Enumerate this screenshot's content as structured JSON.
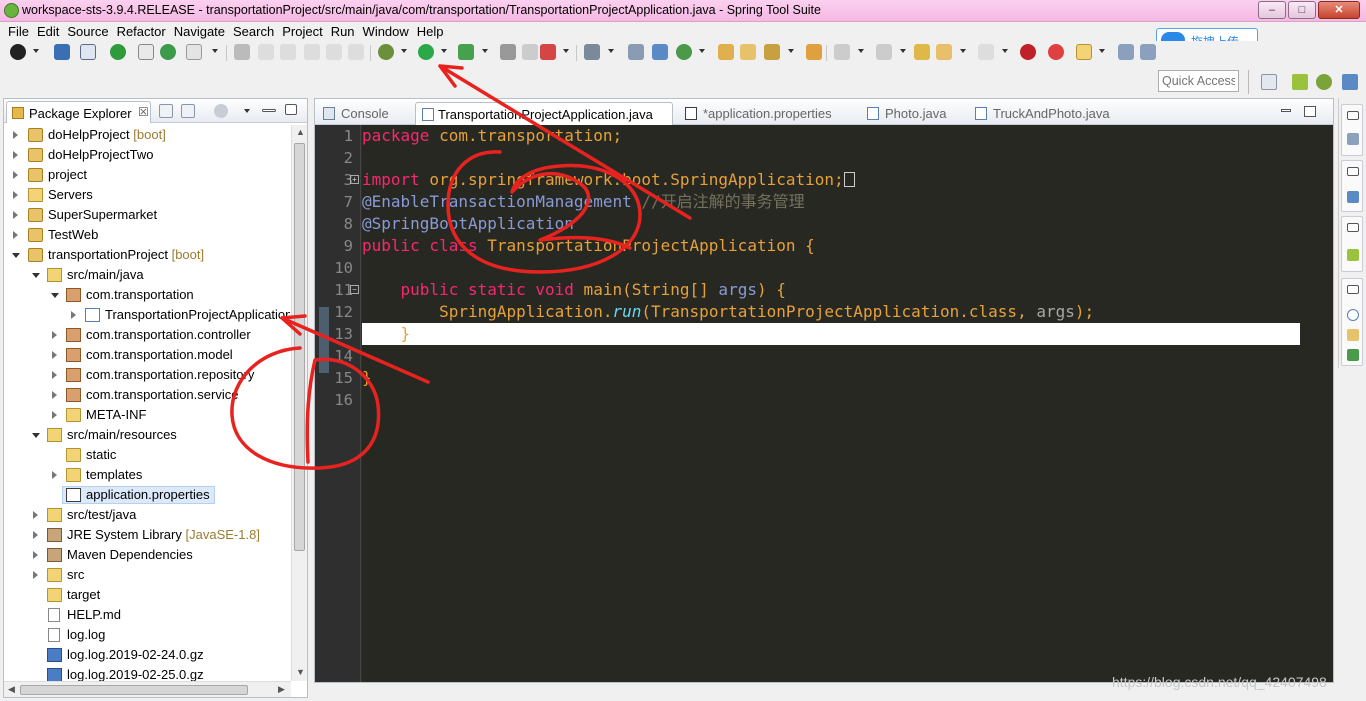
{
  "window": {
    "title": "workspace-sts-3.9.4.RELEASE - transportationProject/src/main/java/com/transportation/TransportationProjectApplication.java - Spring Tool Suite",
    "minimize": "–",
    "maximize": "□",
    "close": "✕"
  },
  "menu": [
    "File",
    "Edit",
    "Source",
    "Refactor",
    "Navigate",
    "Search",
    "Project",
    "Run",
    "Window",
    "Help"
  ],
  "upload": {
    "label": "拖拽上传"
  },
  "quick_access": {
    "placeholder": "Quick Access"
  },
  "package_explorer": {
    "tab_label": "Package Explorer",
    "close_glyph": "☒",
    "tree": [
      {
        "label": "doHelpProject",
        "decoration": "[boot]",
        "icon": "project-icon",
        "twisty": "closed"
      },
      {
        "label": "doHelpProjectTwo",
        "decoration": "",
        "icon": "project-icon",
        "twisty": "closed"
      },
      {
        "label": "project",
        "decoration": "",
        "icon": "project-icon",
        "twisty": "closed"
      },
      {
        "label": "Servers",
        "decoration": "",
        "icon": "folder-icon",
        "twisty": "closed"
      },
      {
        "label": "SuperSupermarket",
        "decoration": "",
        "icon": "project-icon",
        "twisty": "closed"
      },
      {
        "label": "TestWeb",
        "decoration": "",
        "icon": "project-icon",
        "twisty": "closed"
      },
      {
        "label": "transportationProject",
        "decoration": "[boot]",
        "icon": "project-icon",
        "twisty": "open"
      },
      {
        "label": "src/main/java",
        "decoration": "",
        "icon": "source-folder-icon",
        "twisty": "open"
      },
      {
        "label": "com.transportation",
        "decoration": "",
        "icon": "package-icon",
        "twisty": "open"
      },
      {
        "label": "TransportationProjectApplication.java",
        "decoration": "",
        "icon": "java-file-icon",
        "twisty": "closed"
      },
      {
        "label": "com.transportation.controller",
        "decoration": "",
        "icon": "package-icon",
        "twisty": "closed"
      },
      {
        "label": "com.transportation.model",
        "decoration": "",
        "icon": "package-icon",
        "twisty": "closed"
      },
      {
        "label": "com.transportation.repository",
        "decoration": "",
        "icon": "package-icon",
        "twisty": "closed"
      },
      {
        "label": "com.transportation.service",
        "decoration": "",
        "icon": "package-icon",
        "twisty": "closed"
      },
      {
        "label": "META-INF",
        "decoration": "",
        "icon": "folder-icon",
        "twisty": "closed"
      },
      {
        "label": "src/main/resources",
        "decoration": "",
        "icon": "source-folder-icon",
        "twisty": "open"
      },
      {
        "label": "static",
        "decoration": "",
        "icon": "folder-icon",
        "twisty": "none"
      },
      {
        "label": "templates",
        "decoration": "",
        "icon": "folder-icon",
        "twisty": "closed"
      },
      {
        "label": "application.properties",
        "decoration": "",
        "icon": "properties-file-icon",
        "twisty": "none"
      },
      {
        "label": "src/test/java",
        "decoration": "",
        "icon": "source-folder-icon",
        "twisty": "closed"
      },
      {
        "label": "JRE System Library",
        "decoration": "[JavaSE-1.8]",
        "icon": "library-icon",
        "twisty": "closed"
      },
      {
        "label": "Maven Dependencies",
        "decoration": "",
        "icon": "library-icon",
        "twisty": "closed"
      },
      {
        "label": "src",
        "decoration": "",
        "icon": "folder-icon",
        "twisty": "closed"
      },
      {
        "label": "target",
        "decoration": "",
        "icon": "folder-icon",
        "twisty": "none"
      },
      {
        "label": "HELP.md",
        "decoration": "",
        "icon": "file-icon",
        "twisty": "none"
      },
      {
        "label": "log.log",
        "decoration": "",
        "icon": "file-icon",
        "twisty": "none"
      },
      {
        "label": "log.log.2019-02-24.0.gz",
        "decoration": "",
        "icon": "archive-icon",
        "twisty": "none"
      },
      {
        "label": "log.log.2019-02-25.0.gz",
        "decoration": "",
        "icon": "archive-icon",
        "twisty": "none"
      }
    ]
  },
  "editor": {
    "tabs": [
      {
        "label": "Console",
        "active": false,
        "icon": "console-icon"
      },
      {
        "label": "TransportationProjectApplication.java",
        "active": true,
        "icon": "java-file-icon"
      },
      {
        "label": "*application.properties",
        "active": false,
        "icon": "properties-file-icon"
      },
      {
        "label": "Photo.java",
        "active": false,
        "icon": "java-file-icon"
      },
      {
        "label": "TruckAndPhoto.java",
        "active": false,
        "icon": "java-file-icon"
      }
    ],
    "line_numbers": [
      "1",
      "2",
      "3",
      "7",
      "8",
      "9",
      "10",
      "11",
      "12",
      "13",
      "14",
      "15",
      "16"
    ],
    "code": {
      "l1_kw": "package",
      "l1_rest": " com.transportation;",
      "l3_kw": "import",
      "l3_rest": " org.springframework.boot.SpringApplication;",
      "l7_ann": "@EnableTransactionManagement",
      "l7_comment": " //开启注解的事务管理",
      "l8_ann": "@SpringBootApplication",
      "l9_kw": "public class",
      "l9_rest": " TransportationProjectApplication {",
      "l11_indent": "    ",
      "l11_kw": "public static void",
      "l11_method": " main",
      "l11_paren": "(",
      "l11_type": "String[]",
      "l11_arg": " args",
      "l11_end": ") {",
      "l12_indent": "        ",
      "l12_cls": "SpringApplication",
      "l12_dot": ".",
      "l12_run": "run",
      "l12_open": "(",
      "l12_target": "TransportationProjectApplication",
      "l12_class": ".class",
      "l12_comma": ", ",
      "l12_args": "args",
      "l12_close": ");",
      "l13_indent": "    ",
      "l13_brace": "}",
      "l15_brace": "}"
    }
  },
  "watermark": "https://blog.csdn.net/qq_42407498",
  "colors": {
    "annotation_stroke": "#e8231f",
    "editor_bg": "#272822",
    "keyword": "#f92672",
    "string_orange": "#e6a13b"
  }
}
